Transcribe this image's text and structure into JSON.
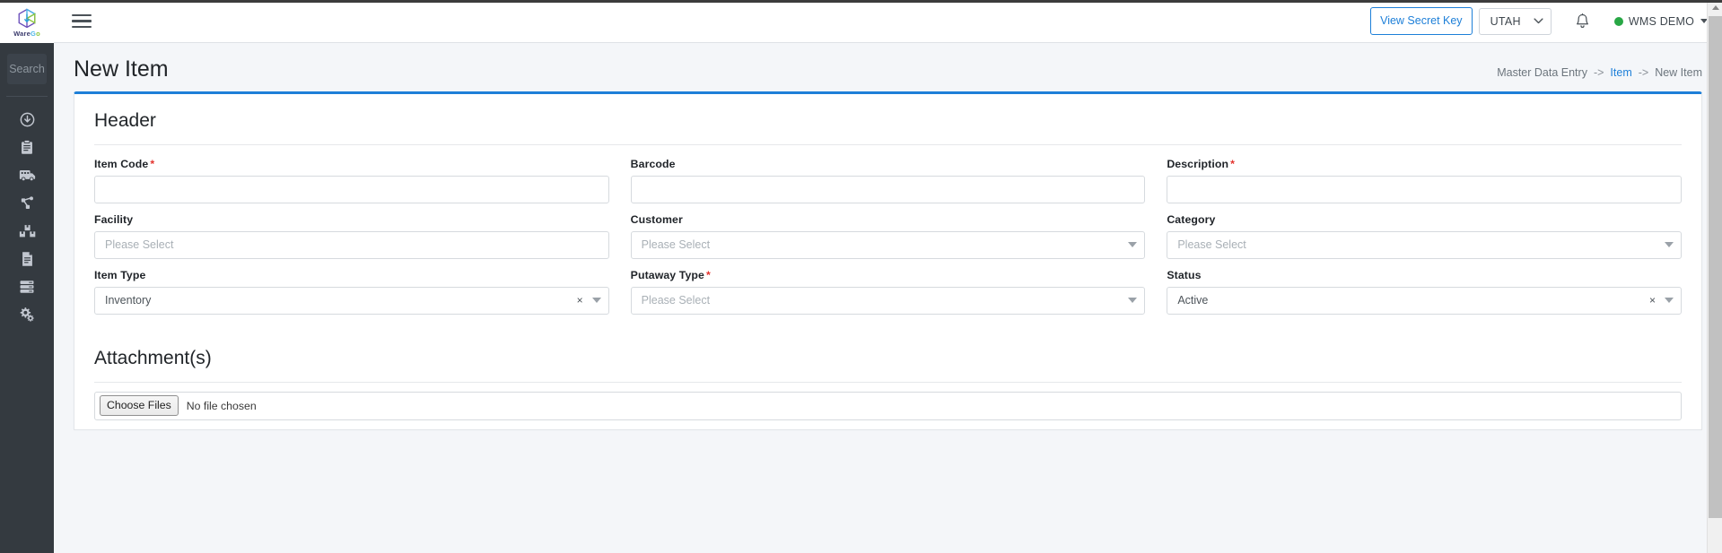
{
  "brand": {
    "name_part1": "Ware",
    "name_part2": "G",
    "name_part3": "o",
    "logo_icon": "cube-icon"
  },
  "sidebar": {
    "search_placeholder": "Search",
    "items": [
      {
        "icon": "inbound-arrow-icon",
        "name": "sidebar-item-inbound"
      },
      {
        "icon": "clipboard-icon",
        "name": "sidebar-item-orders"
      },
      {
        "icon": "truck-icon",
        "name": "sidebar-item-shipping"
      },
      {
        "icon": "hierarchy-icon",
        "name": "sidebar-item-workflow"
      },
      {
        "icon": "boxes-icon",
        "name": "sidebar-item-inventory"
      },
      {
        "icon": "document-icon",
        "name": "sidebar-item-reports"
      },
      {
        "icon": "server-icon",
        "name": "sidebar-item-master-data"
      },
      {
        "icon": "gears-icon",
        "name": "sidebar-item-settings"
      }
    ]
  },
  "topbar": {
    "menu_icon": "hamburger-icon",
    "secret_key_label": "View Secret Key",
    "site_value": "UTAH",
    "bell_icon": "bell-icon",
    "user_name": "WMS DEMO",
    "status_color": "#28a745",
    "accent_color": "#1d7fd8"
  },
  "page": {
    "title": "New Item",
    "breadcrumb": {
      "root": "Master Data Entry",
      "sep1": "->",
      "link": "Item",
      "sep2": "->",
      "current": "New Item"
    }
  },
  "header_section": {
    "title": "Header",
    "fields": [
      {
        "label": "Item Code",
        "required": true,
        "type": "text",
        "value": "",
        "placeholder": "",
        "name": "item-code"
      },
      {
        "label": "Barcode",
        "required": false,
        "type": "text",
        "value": "",
        "placeholder": "",
        "name": "barcode"
      },
      {
        "label": "Description",
        "required": true,
        "type": "text",
        "value": "",
        "placeholder": "",
        "name": "description"
      },
      {
        "label": "Facility",
        "required": false,
        "type": "select",
        "value": "",
        "placeholder": "Please Select",
        "clearable": false,
        "arrow": false,
        "name": "facility"
      },
      {
        "label": "Customer",
        "required": false,
        "type": "select",
        "value": "",
        "placeholder": "Please Select",
        "clearable": false,
        "arrow": true,
        "name": "customer"
      },
      {
        "label": "Category",
        "required": false,
        "type": "select",
        "value": "",
        "placeholder": "Please Select",
        "clearable": false,
        "arrow": true,
        "name": "category"
      },
      {
        "label": "Item Type",
        "required": false,
        "type": "select",
        "value": "Inventory",
        "placeholder": "Please Select",
        "clearable": true,
        "arrow": true,
        "name": "item-type"
      },
      {
        "label": "Putaway Type",
        "required": true,
        "type": "select",
        "value": "",
        "placeholder": "Please Select",
        "clearable": false,
        "arrow": true,
        "name": "putaway-type"
      },
      {
        "label": "Status",
        "required": false,
        "type": "select",
        "value": "Active",
        "placeholder": "Please Select",
        "clearable": true,
        "arrow": true,
        "name": "status"
      }
    ]
  },
  "attachments_section": {
    "title": "Attachment(s)",
    "choose_files_label": "Choose Files",
    "no_file_text": "No file chosen"
  },
  "clear_symbol": "×"
}
